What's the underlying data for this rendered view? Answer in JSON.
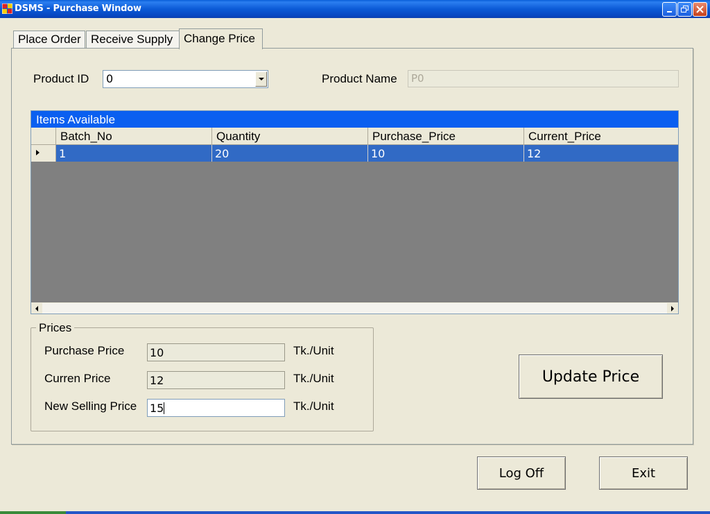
{
  "window": {
    "title": "DSMS - Purchase Window",
    "titlebar_color": "#0a5fd8"
  },
  "tabs": [
    {
      "label": "Place Order",
      "active": false
    },
    {
      "label": "Receive Supply",
      "active": false
    },
    {
      "label": "Change Price",
      "active": true
    }
  ],
  "product": {
    "id_label": "Product ID",
    "id_value": "0",
    "name_label": "Product Name",
    "name_value": "P0"
  },
  "grid": {
    "caption": "Items Available",
    "columns": [
      "Batch_No",
      "Quantity",
      "Purchase_Price",
      "Current_Price"
    ],
    "rows": [
      [
        "1",
        "20",
        "10",
        "12"
      ]
    ],
    "selection_color": "#316ac5"
  },
  "prices": {
    "group_label": "Prices",
    "purchase_label": "Purchase Price",
    "purchase_value": "10",
    "current_label": "Curren Price",
    "current_value": "12",
    "new_label": "New Selling Price",
    "new_value": "15",
    "unit": "Tk./Unit"
  },
  "actions": {
    "update_price": "Update Price",
    "log_off": "Log Off",
    "exit": "Exit"
  }
}
